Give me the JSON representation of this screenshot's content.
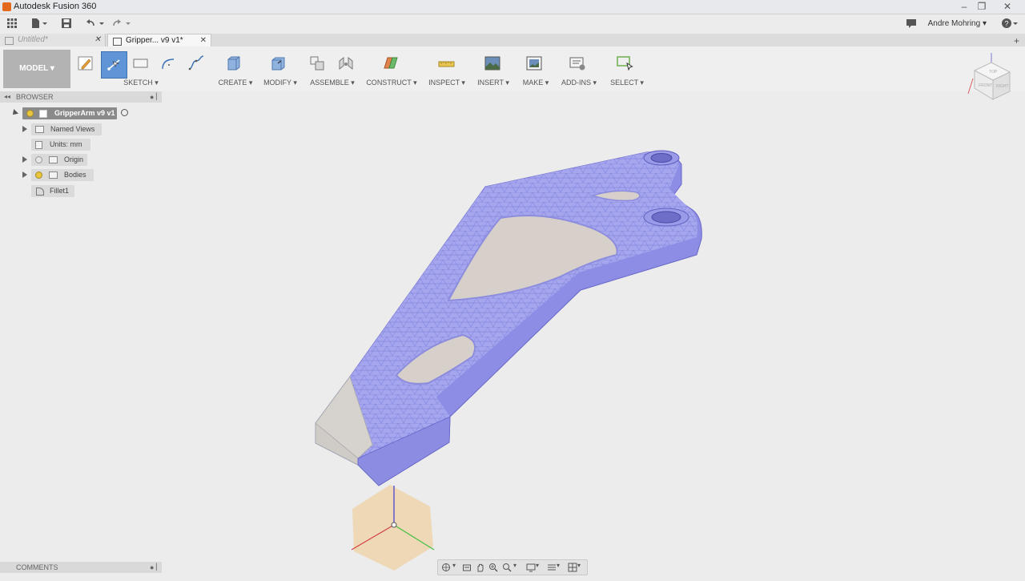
{
  "window": {
    "title": "Autodesk Fusion 360"
  },
  "user": {
    "name": "Andre Mohring"
  },
  "tabs": [
    {
      "label": "Untitled*",
      "active": false
    },
    {
      "label": "Gripper... v9 v1*",
      "active": true
    }
  ],
  "workspace": {
    "label": "MODEL ▾"
  },
  "ribbon": {
    "groups": [
      {
        "label": "SKETCH ▾"
      },
      {
        "label": "CREATE ▾"
      },
      {
        "label": "MODIFY ▾"
      },
      {
        "label": "ASSEMBLE ▾"
      },
      {
        "label": "CONSTRUCT ▾"
      },
      {
        "label": "INSPECT ▾"
      },
      {
        "label": "INSERT ▾"
      },
      {
        "label": "MAKE ▾"
      },
      {
        "label": "ADD-INS ▾"
      },
      {
        "label": "SELECT ▾"
      }
    ]
  },
  "browser": {
    "header": "BROWSER",
    "root": "GripperArm v9 v1",
    "items": [
      {
        "label": "Named Views"
      },
      {
        "label": "Units: mm"
      },
      {
        "label": "Origin"
      },
      {
        "label": "Bodies"
      },
      {
        "label": "Fillet1"
      }
    ]
  },
  "comments": {
    "header": "COMMENTS"
  },
  "viewcube": {
    "top": "TOP",
    "front": "FRONT",
    "right": "RIGHT"
  },
  "colors": {
    "mesh": "#a3a3ee",
    "mesh_edge": "#6a6ad0",
    "cutout": "#d7d0ca",
    "origin_plane": "#f0c98a"
  }
}
